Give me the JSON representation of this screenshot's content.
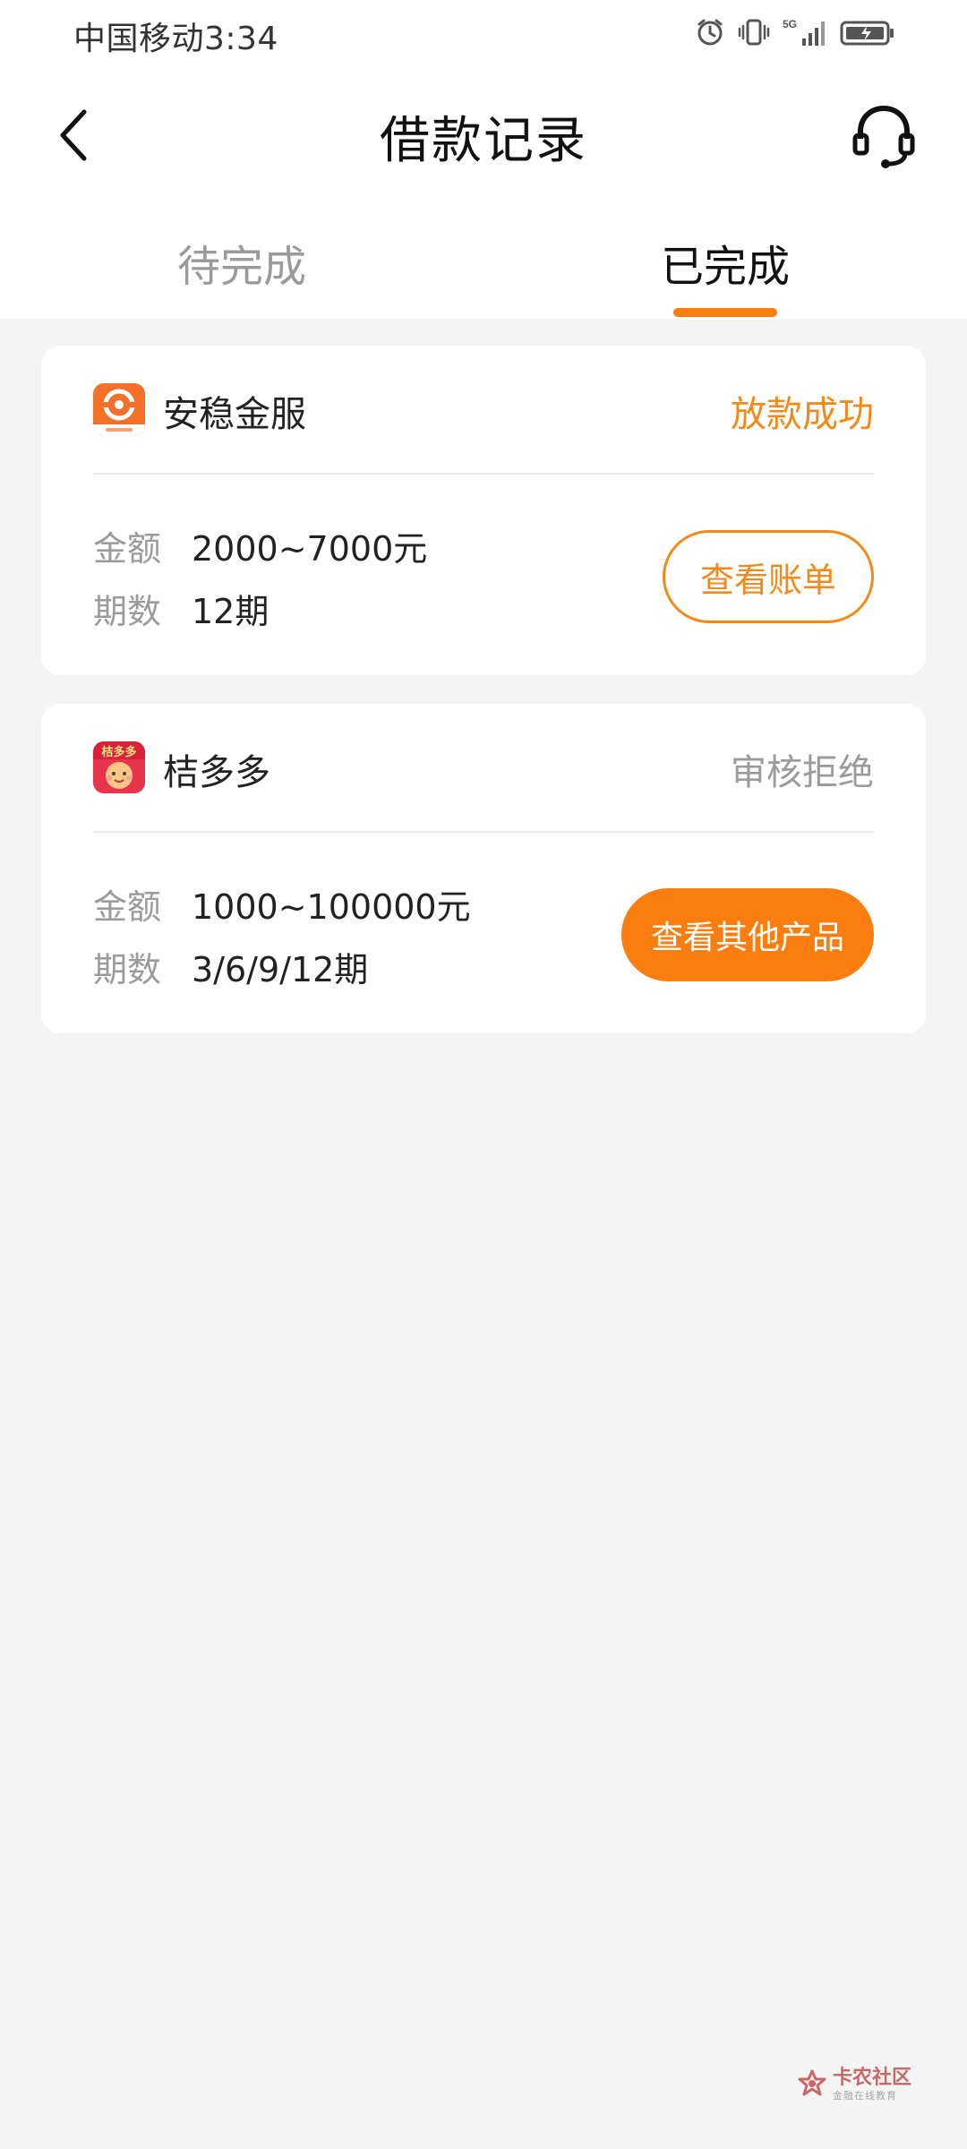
{
  "status_bar": {
    "carrier_time": "中国移动3:34",
    "network": "5G"
  },
  "header": {
    "title": "借款记录",
    "back_icon": "chevron-left-icon",
    "service_icon": "headset-icon"
  },
  "tabs": [
    {
      "label": "待完成",
      "active": false
    },
    {
      "label": "已完成",
      "active": true
    }
  ],
  "records": [
    {
      "product": "安稳金服",
      "status": "放款成功",
      "amount_label": "金额",
      "amount": "2000~7000元",
      "term_label": "期数",
      "term": "12期",
      "action": "查看账单"
    },
    {
      "product": "桔多多",
      "logo_text": "桔多多",
      "status": "审核拒绝",
      "amount_label": "金额",
      "amount": "1000~100000元",
      "term_label": "期数",
      "term": "3/6/9/12期",
      "action": "查看其他产品"
    }
  ],
  "watermark": {
    "title": "卡农社区",
    "subtitle": "金融在线教育"
  },
  "colors": {
    "accent": "#fb7d0f",
    "status_ok": "#f18a1a",
    "muted": "#9b9b9b",
    "background": "#f4f4f4"
  }
}
